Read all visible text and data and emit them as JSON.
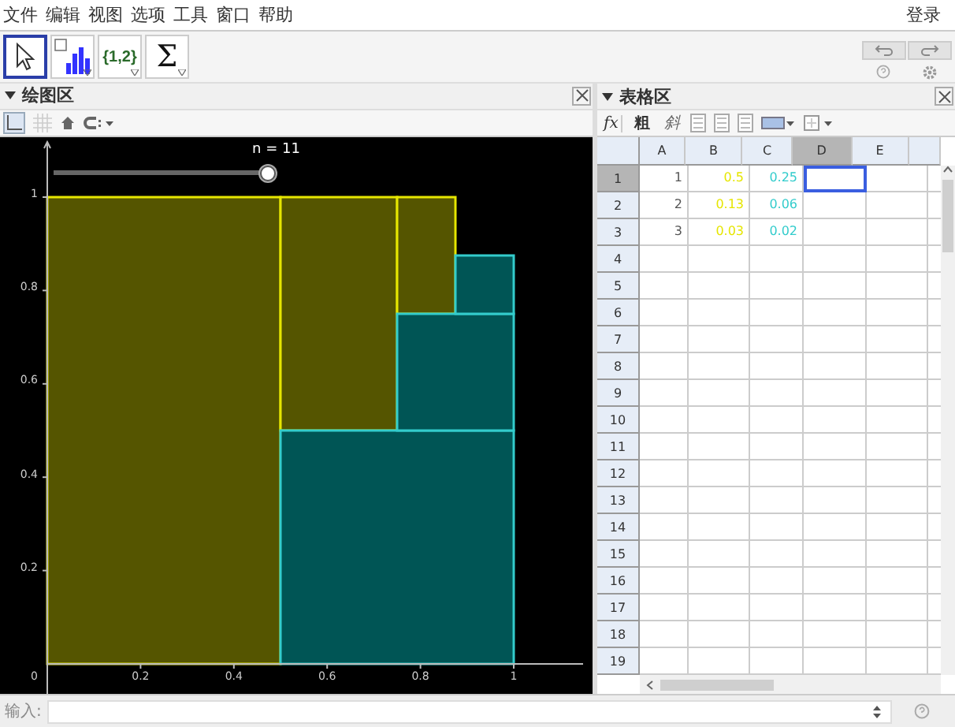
{
  "menu": [
    "文件",
    "编辑",
    "视图",
    "选项",
    "工具",
    "窗口",
    "帮助"
  ],
  "login": "登录",
  "tools": [
    {
      "kind": "move",
      "selected": true
    },
    {
      "kind": "chart",
      "selected": false
    },
    {
      "kind": "list",
      "label": "{1,2}",
      "selected": false
    },
    {
      "kind": "sum",
      "label": "Σ",
      "selected": false
    }
  ],
  "graphics": {
    "title": "绘图区",
    "slider": {
      "label": "n = 11",
      "level": 1
    },
    "origin_label": "0",
    "x_ticks": [
      "0.2",
      "0.4",
      "0.6",
      "0.8",
      "1"
    ],
    "y_ticks": [
      "1",
      "0.8",
      "0.6",
      "0.4",
      "0.2"
    ]
  },
  "spreadsheet": {
    "title": "表格区",
    "formula_button": "fx",
    "bold_button": "粗",
    "italic_button": "斜",
    "columns": [
      {
        "label": "A",
        "selected": false
      },
      {
        "label": "B",
        "selected": false
      },
      {
        "label": "C",
        "selected": false
      },
      {
        "label": "D",
        "selected": true
      },
      {
        "label": "E",
        "selected": false
      }
    ],
    "rows": [
      {
        "label": "1",
        "selected": true,
        "cells": [
          {
            "text": "1",
            "color": "#555555",
            "selected": false
          },
          {
            "text": "0.5",
            "color": "#e6e600",
            "selected": false
          },
          {
            "text": "0.25",
            "color": "#33cccc",
            "selected": false
          },
          {
            "selected": true
          },
          {
            "selected": false
          }
        ]
      },
      {
        "label": "2",
        "selected": false,
        "cells": [
          {
            "text": "2",
            "color": "#555555",
            "selected": false
          },
          {
            "text": "0.13",
            "color": "#e6e600",
            "selected": false
          },
          {
            "text": "0.06",
            "color": "#33cccc",
            "selected": false
          },
          {
            "selected": false
          },
          {
            "selected": false
          }
        ]
      },
      {
        "label": "3",
        "selected": false,
        "cells": [
          {
            "text": "3",
            "color": "#555555",
            "selected": false
          },
          {
            "text": "0.03",
            "color": "#e6e600",
            "selected": false
          },
          {
            "text": "0.02",
            "color": "#33cccc",
            "selected": false
          },
          {
            "selected": false
          },
          {
            "selected": false
          }
        ]
      },
      {
        "label": "4",
        "selected": false
      },
      {
        "label": "5",
        "selected": false
      },
      {
        "label": "6",
        "selected": false
      },
      {
        "label": "7",
        "selected": false
      },
      {
        "label": "8",
        "selected": false
      },
      {
        "label": "9",
        "selected": false
      },
      {
        "label": "10",
        "selected": false
      },
      {
        "label": "11",
        "selected": false
      },
      {
        "label": "12",
        "selected": false
      },
      {
        "label": "13",
        "selected": false
      },
      {
        "label": "14",
        "selected": false
      },
      {
        "label": "15",
        "selected": false
      },
      {
        "label": "16",
        "selected": false
      },
      {
        "label": "17",
        "selected": false
      },
      {
        "label": "18",
        "selected": false
      },
      {
        "label": "19",
        "selected": false
      }
    ]
  },
  "input_bar": {
    "label": "输入:"
  }
}
